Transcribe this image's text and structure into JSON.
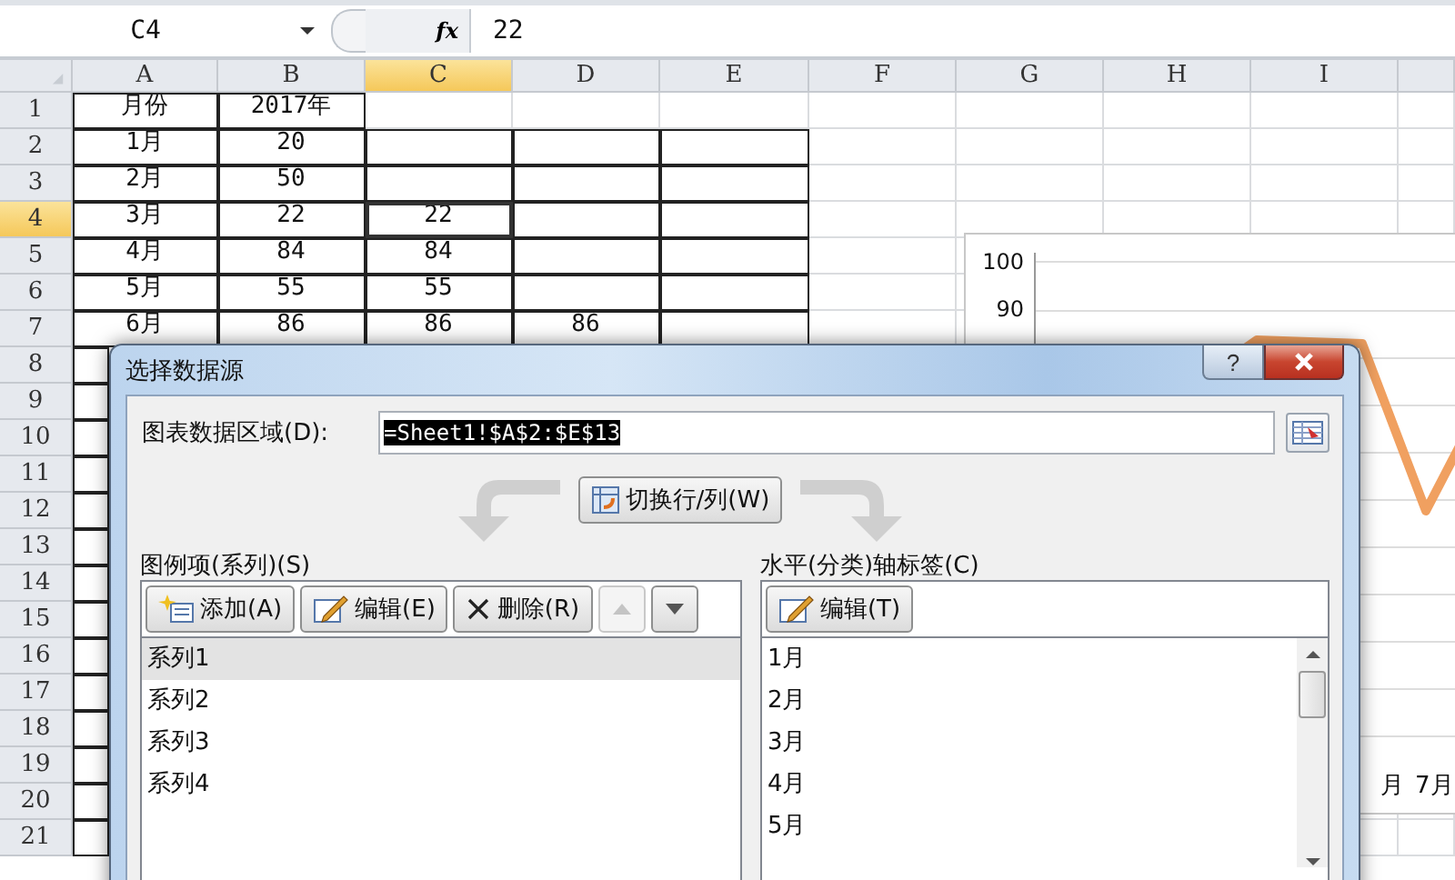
{
  "formula_bar": {
    "name_box": "C4",
    "function_button": "fx",
    "formula": "22"
  },
  "sheet": {
    "columns": [
      {
        "label": "A",
        "selected": false
      },
      {
        "label": "B",
        "selected": false
      },
      {
        "label": "C",
        "selected": true
      },
      {
        "label": "D",
        "selected": false
      },
      {
        "label": "E",
        "selected": false
      },
      {
        "label": "F",
        "selected": false
      },
      {
        "label": "G",
        "selected": false
      },
      {
        "label": "H",
        "selected": false
      },
      {
        "label": "I",
        "selected": false
      }
    ],
    "rows": [
      {
        "label": "1",
        "selected": false,
        "cells": {
          "A": "月份",
          "B": "2017年"
        }
      },
      {
        "label": "2",
        "selected": false,
        "cells": {
          "A": "1月",
          "B": "20"
        }
      },
      {
        "label": "3",
        "selected": false,
        "cells": {
          "A": "2月",
          "B": "50"
        }
      },
      {
        "label": "4",
        "selected": true,
        "cells": {
          "A": "3月",
          "B": "22",
          "C": "22"
        }
      },
      {
        "label": "5",
        "selected": false,
        "cells": {
          "A": "4月",
          "B": "84",
          "C": "84"
        }
      },
      {
        "label": "6",
        "selected": false,
        "cells": {
          "A": "5月",
          "B": "55",
          "C": "55"
        }
      },
      {
        "label": "7",
        "selected": false,
        "cells": {
          "A": "6月",
          "B": "86",
          "C": "86",
          "D": "86"
        }
      },
      {
        "label": "8",
        "selected": false,
        "cells": {}
      },
      {
        "label": "9",
        "selected": false,
        "cells": {}
      },
      {
        "label": "10",
        "selected": false,
        "cells": {}
      },
      {
        "label": "11",
        "selected": false,
        "cells": {}
      },
      {
        "label": "12",
        "selected": false,
        "cells": {}
      },
      {
        "label": "13",
        "selected": false,
        "cells": {}
      },
      {
        "label": "14",
        "selected": false,
        "cells": {}
      },
      {
        "label": "15",
        "selected": false,
        "cells": {}
      },
      {
        "label": "16",
        "selected": false,
        "cells": {}
      },
      {
        "label": "17",
        "selected": false,
        "cells": {}
      },
      {
        "label": "18",
        "selected": false,
        "cells": {}
      },
      {
        "label": "19",
        "selected": false,
        "cells": {}
      },
      {
        "label": "20",
        "selected": false,
        "cells": {}
      },
      {
        "label": "21",
        "selected": false,
        "cells": {}
      }
    ]
  },
  "chart": {
    "y_ticks": [
      "100",
      "90"
    ],
    "x_labels": [
      "月",
      "7月"
    ]
  },
  "dialog": {
    "title": "选择数据源",
    "help_button": "?",
    "range_label": "图表数据区域(D):",
    "range_value": "=Sheet1!$A$2:$E$13",
    "range_value_selected": true,
    "switch_button": "切换行/列(W)",
    "series_panel": {
      "label": "图例项(系列)(S)",
      "buttons": [
        {
          "kind": "add",
          "label": "添加(A)",
          "disabled": false
        },
        {
          "kind": "edit",
          "label": "编辑(E)",
          "disabled": false
        },
        {
          "kind": "delete",
          "label": "删除(R)",
          "disabled": false
        },
        {
          "kind": "up",
          "disabled": true
        },
        {
          "kind": "down",
          "disabled": false
        }
      ],
      "items": [
        {
          "label": "系列1",
          "selected": true
        },
        {
          "label": "系列2",
          "selected": false
        },
        {
          "label": "系列3",
          "selected": false
        },
        {
          "label": "系列4",
          "selected": false
        }
      ]
    },
    "axis_panel": {
      "label": "水平(分类)轴标签(C)",
      "buttons": [
        {
          "kind": "edit",
          "label": "编辑(T)",
          "disabled": false
        }
      ],
      "items": [
        {
          "label": "1月",
          "selected": false
        },
        {
          "label": "2月",
          "selected": false
        },
        {
          "label": "3月",
          "selected": false
        },
        {
          "label": "4月",
          "selected": false
        },
        {
          "label": "5月",
          "selected": false
        }
      ]
    }
  }
}
